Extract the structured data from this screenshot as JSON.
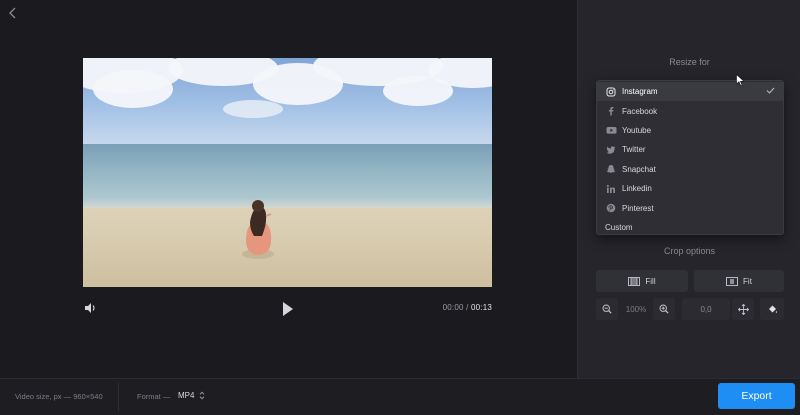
{
  "player": {
    "current_time": "00:00",
    "separator": " / ",
    "total_time": "00:13"
  },
  "resize_panel": {
    "title": "Resize for",
    "options": [
      {
        "label": "Instagram",
        "icon": "instagram-icon",
        "selected": true
      },
      {
        "label": "Facebook",
        "icon": "facebook-icon",
        "selected": false
      },
      {
        "label": "Youtube",
        "icon": "youtube-icon",
        "selected": false
      },
      {
        "label": "Twitter",
        "icon": "twitter-icon",
        "selected": false
      },
      {
        "label": "Snapchat",
        "icon": "snapchat-icon",
        "selected": false
      },
      {
        "label": "Linkedin",
        "icon": "linkedin-icon",
        "selected": false
      },
      {
        "label": "Pinterest",
        "icon": "pinterest-icon",
        "selected": false
      },
      {
        "label": "Custom",
        "icon": "",
        "selected": false
      }
    ]
  },
  "crop_panel": {
    "title": "Crop options",
    "fill_label": "Fill",
    "fit_label": "Fit",
    "zoom_value": "100%",
    "position_value": "0,0"
  },
  "footer": {
    "video_size": "Video size, px — 960×540",
    "format_label": "Format —",
    "format_value": "MP4",
    "export_label": "Export"
  },
  "colors": {
    "accent": "#1e8ef5",
    "background": "#1a1a1f",
    "panel": "#25252b"
  }
}
